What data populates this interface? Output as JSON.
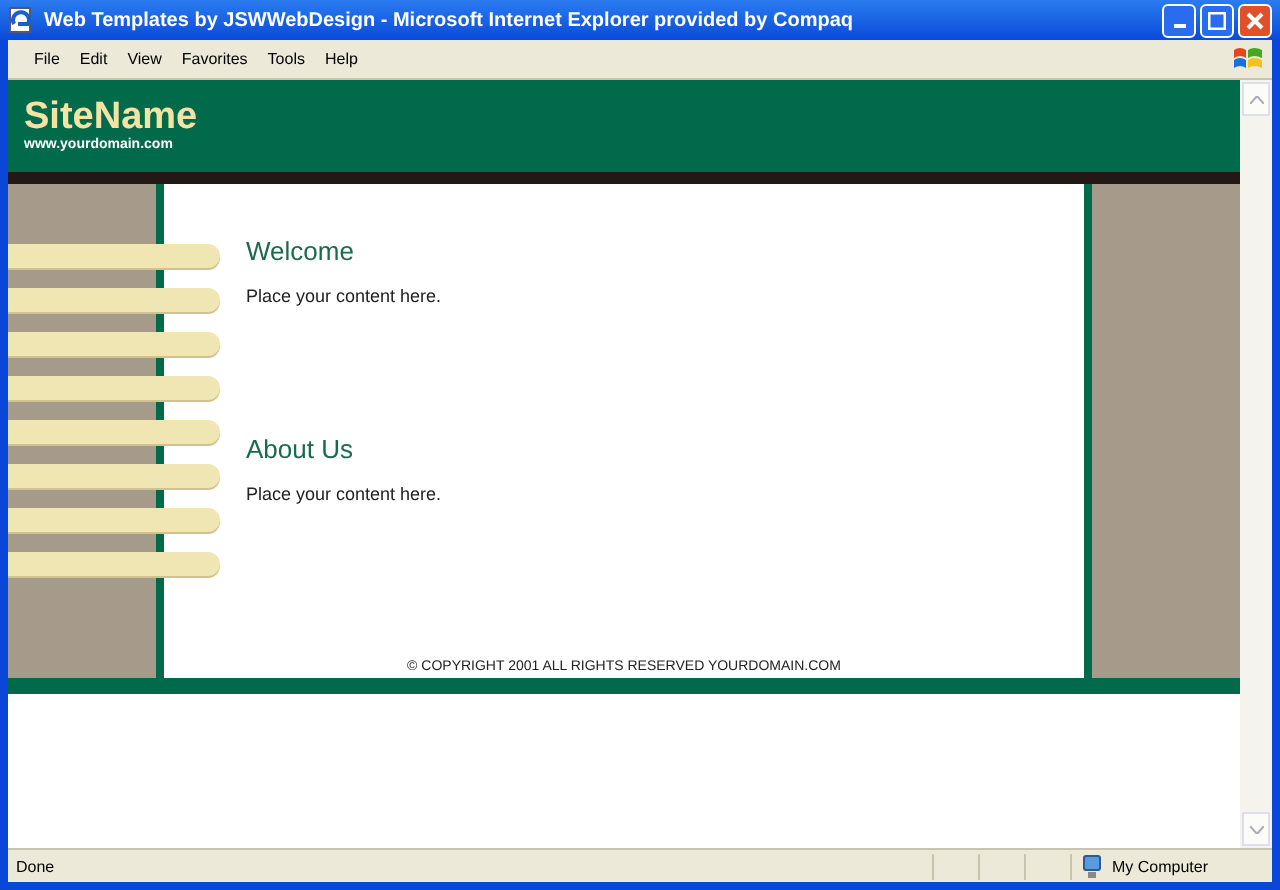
{
  "window": {
    "title": "Web Templates by JSWWebDesign - Microsoft Internet Explorer provided by Compaq"
  },
  "menu": [
    "File",
    "Edit",
    "View",
    "Favorites",
    "Tools",
    "Help"
  ],
  "page": {
    "site_name": "SiteName",
    "domain": "www.yourdomain.com",
    "nav_buttons": [
      {
        "kind": "pill"
      },
      {
        "kind": "pill"
      },
      {
        "kind": "pill"
      },
      {
        "kind": "pill"
      },
      {
        "kind": "pill"
      },
      {
        "kind": "pill"
      },
      {
        "kind": "pill"
      },
      {
        "kind": "pill"
      }
    ],
    "sections": [
      {
        "heading": "Welcome",
        "body": "Place your content here."
      },
      {
        "heading": "About Us",
        "body": "Place your content here."
      }
    ],
    "copyright": "© COPYRIGHT 2001 ALL RIGHTS RESERVED YOURDOMAIN.COM"
  },
  "status_bar": {
    "text": "Done",
    "zone": "My Computer"
  }
}
